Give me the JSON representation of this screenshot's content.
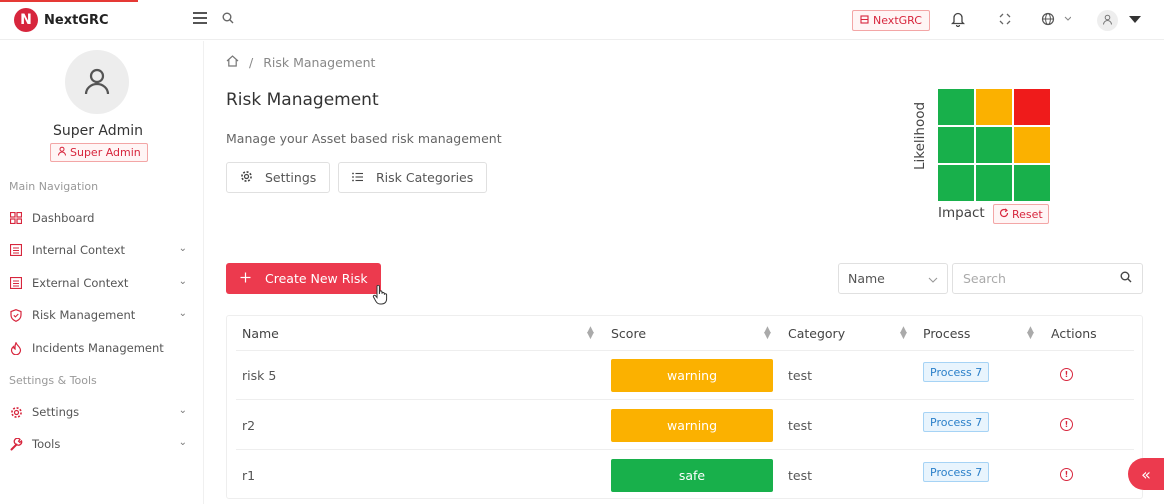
{
  "app": {
    "logo_letter": "N",
    "name": "NextGRC",
    "brand_color": "#d7263d",
    "accent_color": "#ec3a4e"
  },
  "header": {
    "org_badge": "NextGRC",
    "icons": [
      "menu-icon",
      "search-icon",
      "bell-icon",
      "fullscreen-icon",
      "globe-icon",
      "user-icon"
    ]
  },
  "sidebar": {
    "user_name": "Super Admin",
    "role": "Super Admin",
    "section_main": "Main Navigation",
    "section_tools": "Settings & Tools",
    "items": [
      {
        "label": "Dashboard",
        "icon": "grid-icon"
      },
      {
        "label": "Internal Context",
        "icon": "list-icon"
      },
      {
        "label": "External Context",
        "icon": "list-icon"
      },
      {
        "label": "Risk Management",
        "icon": "shield-icon"
      },
      {
        "label": "Incidents Management",
        "icon": "flame-icon"
      },
      {
        "label": "Settings",
        "icon": "gear-icon"
      },
      {
        "label": "Tools",
        "icon": "wrench-icon"
      }
    ]
  },
  "breadcrumb": {
    "current": "Risk Management"
  },
  "page": {
    "title": "Risk Management",
    "subtitle": "Manage your Asset based risk management",
    "settings_label": "Settings",
    "categories_label": "Risk Categories"
  },
  "matrix": {
    "y_label": "Likelihood",
    "x_label": "Impact",
    "reset_label": "Reset",
    "colors": {
      "green": "#18b04b",
      "amber": "#fbb100",
      "red": "#ef1b1b"
    },
    "cells": [
      [
        "green",
        "amber",
        "red"
      ],
      [
        "green",
        "green",
        "amber"
      ],
      [
        "green",
        "green",
        "green"
      ]
    ]
  },
  "toolbar": {
    "create_label": "Create New Risk",
    "filter_value": "Name",
    "search_placeholder": "Search"
  },
  "table": {
    "columns": [
      "Name",
      "Score",
      "Category",
      "Process",
      "Actions"
    ],
    "rows": [
      {
        "name": "risk 5",
        "score": "warning",
        "score_color": "#fbb100",
        "category": "test",
        "process": "Process 7"
      },
      {
        "name": "r2",
        "score": "warning",
        "score_color": "#fbb100",
        "category": "test",
        "process": "Process 7"
      },
      {
        "name": "r1",
        "score": "safe",
        "score_color": "#18b04b",
        "category": "test",
        "process": "Process 7"
      }
    ]
  }
}
